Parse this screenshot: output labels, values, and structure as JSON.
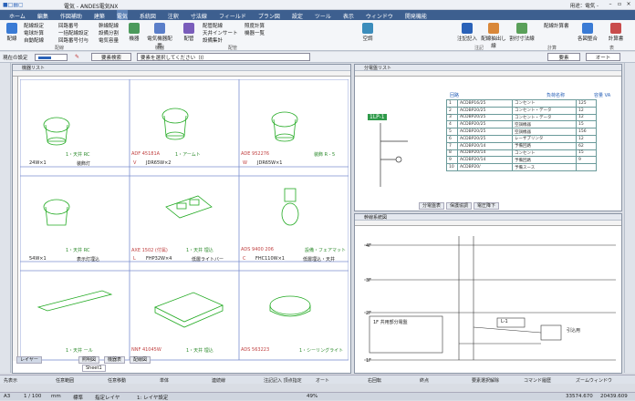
{
  "window": {
    "title": "電気 - ANDES電気NX",
    "right_label": "用途：電気 -"
  },
  "menu": [
    "ホーム",
    "編集",
    "作図補助",
    "建築",
    "電気",
    "系統図",
    "注釈",
    "寸法線",
    "フィールド",
    "プラン図",
    "設定",
    "ツール",
    "表示",
    "ウィンドウ",
    "開発機能"
  ],
  "ribbon": {
    "big1": "配線",
    "big2": "機器",
    "big3": "自動配置",
    "big4": "電気機器配置",
    "big5": "配管",
    "big6": "空調",
    "big7": "注記記入",
    "big8": "配線抽出し線",
    "big9": "割付寸法線",
    "big10": "配線計算書",
    "big11": "各図整合",
    "big12": "計算書",
    "items": [
      "配線設定",
      "電球計算",
      "自動配線",
      "回路番号",
      "一括配線設定",
      "回路番号付与",
      "幹線配線",
      "設備分割",
      "電気容量",
      "配管配線",
      "天井インサート",
      "設備集計",
      "照度計算",
      "機器一覧"
    ],
    "groups": [
      "配線",
      "機器",
      "配管",
      "注記",
      "計算",
      "表"
    ]
  },
  "propbar": {
    "layer_label": "現在の設定",
    "search_button": "要素検索",
    "select_hint": "要素を選択してください（I）",
    "right_combo": "要素",
    "auto": "オート"
  },
  "left_doc": {
    "title": "機器リスト",
    "rows": [
      {
        "labels": [
          "1・天井 RC",
          "ADF 45181A",
          "1・アームト",
          "ADE 952276",
          "装飾 R - 5"
        ],
        "specs": [
          "24W×1",
          "装飾灯",
          "V",
          "JDR65W×2",
          "W",
          "JDR65W×1"
        ]
      },
      {
        "labels": [
          "1・天井 RC",
          "AXE 1502 (付属)",
          "1・天井 埋込",
          "ADS 9400 206",
          "設備・フェアマット"
        ],
        "specs": [
          "54W×1",
          "表示灯埋込",
          "L",
          "FHP32W×4",
          "低層ライトバー",
          "C",
          "FHC110W×1",
          "低層埋込・天井"
        ]
      },
      {
        "labels": [
          "1・天井 ール",
          "NNF 41045W",
          "1・天井 埋込",
          "ADS 563223",
          "1・シーリングライト"
        ]
      }
    ],
    "tabs": [
      "照明図",
      "機器表",
      "配線図"
    ],
    "bottom_tabs": [
      "レイヤー",
      "Sheet1"
    ]
  },
  "schedule": {
    "title": "分電盤リスト",
    "headers": [
      "回路",
      "負荷名称",
      "容量 VA"
    ],
    "panel": "1LP-1",
    "rows": [
      [
        "1",
        "ACDBP16/25",
        "コンセント",
        "125"
      ],
      [
        "2",
        "ACDBP20/25",
        "コンセント・データ",
        "12"
      ],
      [
        "3",
        "ACDBP20/25",
        "コンセント・データ",
        "12"
      ],
      [
        "4",
        "ACDBP20/25",
        "空調機器",
        "15"
      ],
      [
        "5",
        "ACDBP20/25",
        "空調機器",
        "156"
      ],
      [
        "6",
        "ACDBP20/25",
        "レーザプリンタ",
        "12"
      ],
      [
        "7",
        "ACDBP20/14",
        "予備回路",
        "62"
      ],
      [
        "8",
        "ACDBP20/14",
        "コンセント",
        "15"
      ],
      [
        "9",
        "ACDBP20/14",
        "予備回路",
        "9"
      ],
      [
        "10",
        "ACDBP20/",
        "予備スース",
        ""
      ]
    ],
    "tabs": [
      "分電盤表",
      "保護協調",
      "電圧降下"
    ]
  },
  "diagram": {
    "title": "幹線系統図",
    "floors": [
      "4F",
      "3F",
      "2F",
      "1F"
    ],
    "label1": "1F 共用部分電盤",
    "panel": "L-1",
    "tag": "引込用"
  },
  "status": {
    "row1": [
      "先表示",
      "任意範囲",
      "任意移動",
      "単体",
      "連続線",
      "注記記入 頂点指定",
      "オート",
      "右回転",
      "終点",
      "要素選択解除",
      "コマンド履歴",
      "ズームウィンドウ"
    ],
    "row3": [
      "A3",
      "1 / 100",
      "mm",
      "標準",
      "指定レイヤ",
      "1:  レイヤ設定",
      "49%",
      "33574.670",
      "20439.609"
    ]
  }
}
